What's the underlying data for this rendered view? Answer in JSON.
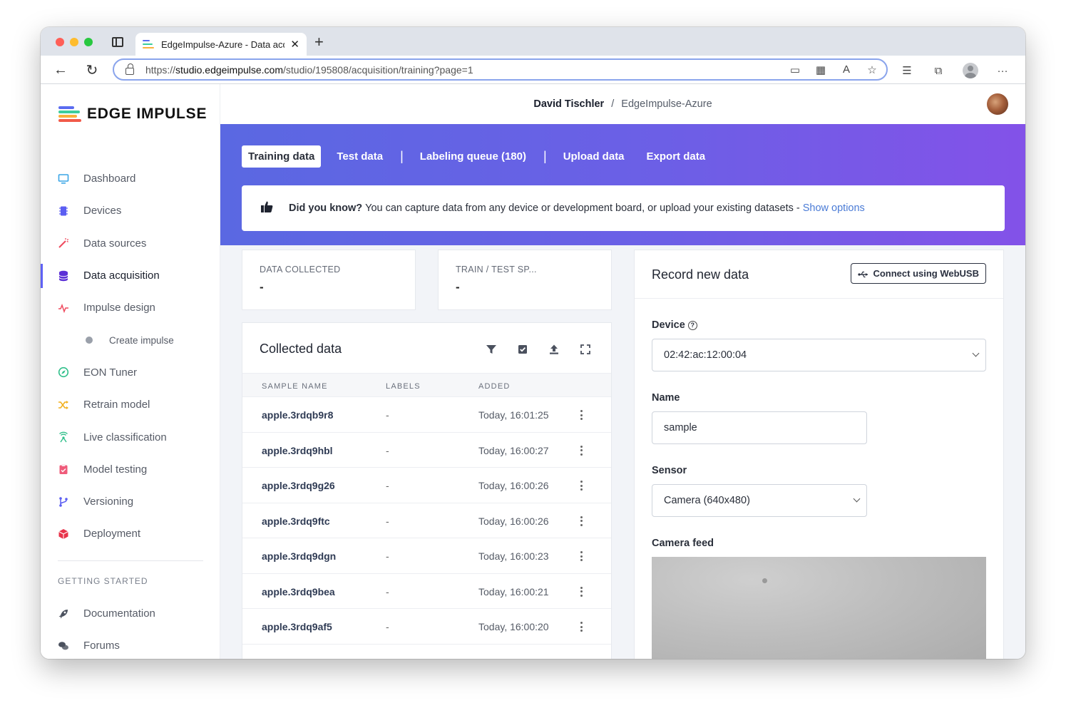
{
  "browser": {
    "tab_title": "EdgeImpulse-Azure - Data acq",
    "tab_close": "✕",
    "new_tab": "+",
    "back": "←",
    "reload": "↻",
    "url_prefix": "https://",
    "url_host": "studio.edgeimpulse.com",
    "url_path": "/studio/195808/acquisition/training?page=1",
    "more": "···"
  },
  "brand": {
    "name": "EDGE IMPULSE",
    "colors": [
      "#5a6cf0",
      "#3ccd9c",
      "#fbb03b",
      "#f15a4a"
    ]
  },
  "sidebar": {
    "items": [
      {
        "label": "Dashboard",
        "icon": "monitor-icon",
        "color": "#3aa5e6"
      },
      {
        "label": "Devices",
        "icon": "chip-icon",
        "color": "#5b5ef2"
      },
      {
        "label": "Data sources",
        "icon": "wand-icon",
        "color": "#ef4a5e"
      },
      {
        "label": "Data acquisition",
        "icon": "database-icon",
        "color": "#5b2fd6",
        "active": true
      },
      {
        "label": "Impulse design",
        "icon": "pulse-icon",
        "color": "#ef4a5e"
      },
      {
        "label": "Create impulse",
        "icon": "dot-icon",
        "sub": true
      },
      {
        "label": "EON Tuner",
        "icon": "compass-icon",
        "color": "#2fbf8a"
      },
      {
        "label": "Retrain model",
        "icon": "shuffle-icon",
        "color": "#f2b01e"
      },
      {
        "label": "Live classification",
        "icon": "broadcast-icon",
        "color": "#2fbf8a"
      },
      {
        "label": "Model testing",
        "icon": "clipboard-icon",
        "color": "#ef5b7a"
      },
      {
        "label": "Versioning",
        "icon": "branch-icon",
        "color": "#5b5ef2"
      },
      {
        "label": "Deployment",
        "icon": "box-icon",
        "color": "#e8334a"
      }
    ],
    "section_title": "GETTING STARTED",
    "bottom_items": [
      {
        "label": "Documentation",
        "icon": "rocket-icon"
      },
      {
        "label": "Forums",
        "icon": "chat-icon"
      }
    ]
  },
  "header": {
    "user": "David Tischler",
    "separator": "/",
    "project": "EdgeImpulse-Azure"
  },
  "subtabs": {
    "training": "Training data",
    "test": "Test data",
    "labeling": "Labeling queue (180)",
    "upload": "Upload data",
    "export": "Export data"
  },
  "tip": {
    "lead": "Did you know?",
    "text": "You can capture data from any device or development board, or upload your existing datasets -",
    "link": "Show options"
  },
  "stats": {
    "collected_label": "DATA COLLECTED",
    "collected_value": "-",
    "split_label": "TRAIN / TEST SP...",
    "split_value": "-"
  },
  "collected": {
    "title": "Collected data",
    "columns": [
      "SAMPLE NAME",
      "LABELS",
      "ADDED"
    ],
    "rows": [
      {
        "name": "apple.3rdqb9r8",
        "labels": "-",
        "added": "Today, 16:01:25"
      },
      {
        "name": "apple.3rdq9hbl",
        "labels": "-",
        "added": "Today, 16:00:27"
      },
      {
        "name": "apple.3rdq9g26",
        "labels": "-",
        "added": "Today, 16:00:26"
      },
      {
        "name": "apple.3rdq9ftc",
        "labels": "-",
        "added": "Today, 16:00:26"
      },
      {
        "name": "apple.3rdq9dgn",
        "labels": "-",
        "added": "Today, 16:00:23"
      },
      {
        "name": "apple.3rdq9bea",
        "labels": "-",
        "added": "Today, 16:00:21"
      },
      {
        "name": "apple.3rdq9af5",
        "labels": "-",
        "added": "Today, 16:00:20"
      }
    ]
  },
  "record": {
    "title": "Record new data",
    "connect_button": "Connect using WebUSB",
    "device_label": "Device",
    "device_value": "02:42:ac:12:00:04",
    "name_label": "Name",
    "name_value": "sample",
    "sensor_label": "Sensor",
    "sensor_value": "Camera (640x480)",
    "camera_label": "Camera feed"
  }
}
